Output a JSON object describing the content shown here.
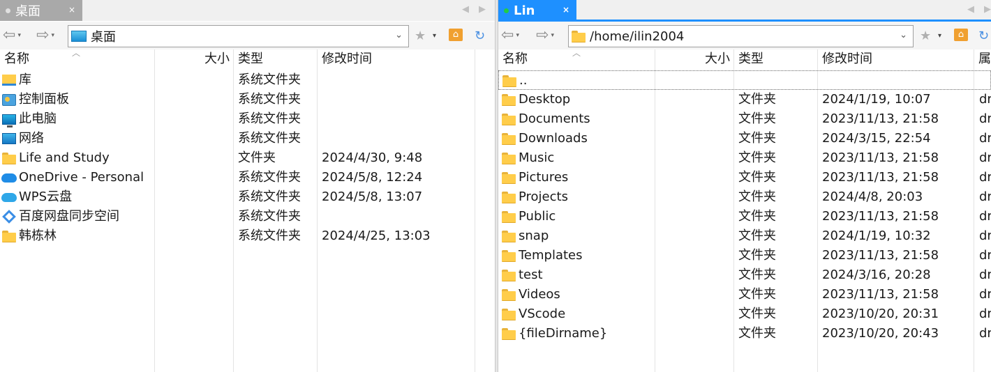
{
  "left": {
    "tab": {
      "label": "桌面",
      "close": "×",
      "dot_color": "#e0e0e0"
    },
    "address": "桌面",
    "columns": {
      "name": "名称",
      "size": "大小",
      "type": "类型",
      "modified": "修改时间"
    },
    "rows": [
      {
        "icon": "library-icon",
        "name": "库",
        "size": "",
        "type": "系统文件夹",
        "modified": ""
      },
      {
        "icon": "control-panel-icon",
        "name": "控制面板",
        "size": "",
        "type": "系统文件夹",
        "modified": ""
      },
      {
        "icon": "this-pc-icon",
        "name": "此电脑",
        "size": "",
        "type": "系统文件夹",
        "modified": ""
      },
      {
        "icon": "network-icon",
        "name": "网络",
        "size": "",
        "type": "系统文件夹",
        "modified": ""
      },
      {
        "icon": "folder-icon",
        "name": "Life and Study",
        "size": "",
        "type": "文件夹",
        "modified": "2024/4/30, 9:48"
      },
      {
        "icon": "onedrive-icon",
        "name": "OneDrive - Personal",
        "size": "",
        "type": "系统文件夹",
        "modified": "2024/5/8, 12:24"
      },
      {
        "icon": "wps-cloud-icon",
        "name": "WPS云盘",
        "size": "",
        "type": "系统文件夹",
        "modified": "2024/5/8, 13:07"
      },
      {
        "icon": "baidu-netdisk-icon",
        "name": "百度网盘同步空间",
        "size": "",
        "type": "系统文件夹",
        "modified": ""
      },
      {
        "icon": "folder-icon",
        "name": "韩栋林",
        "size": "",
        "type": "系统文件夹",
        "modified": "2024/4/25, 13:03"
      }
    ]
  },
  "right": {
    "tab": {
      "label": "Lin",
      "close": "×",
      "dot_color": "#22cc44"
    },
    "address": "/home/ilin2004",
    "columns": {
      "name": "名称",
      "size": "大小",
      "type": "类型",
      "modified": "修改时间",
      "attr": "属"
    },
    "updir": "..",
    "rows": [
      {
        "name": "Desktop",
        "type": "文件夹",
        "modified": "2024/1/19, 10:07",
        "attr": "dr"
      },
      {
        "name": "Documents",
        "type": "文件夹",
        "modified": "2023/11/13, 21:58",
        "attr": "dr"
      },
      {
        "name": "Downloads",
        "type": "文件夹",
        "modified": "2024/3/15, 22:54",
        "attr": "dr"
      },
      {
        "name": "Music",
        "type": "文件夹",
        "modified": "2023/11/13, 21:58",
        "attr": "dr"
      },
      {
        "name": "Pictures",
        "type": "文件夹",
        "modified": "2023/11/13, 21:58",
        "attr": "dr"
      },
      {
        "name": "Projects",
        "type": "文件夹",
        "modified": "2024/4/8, 20:03",
        "attr": "dr"
      },
      {
        "name": "Public",
        "type": "文件夹",
        "modified": "2023/11/13, 21:58",
        "attr": "dr"
      },
      {
        "name": "snap",
        "type": "文件夹",
        "modified": "2024/1/19, 10:32",
        "attr": "dr"
      },
      {
        "name": "Templates",
        "type": "文件夹",
        "modified": "2023/11/13, 21:58",
        "attr": "dr"
      },
      {
        "name": "test",
        "type": "文件夹",
        "modified": "2024/3/16, 20:28",
        "attr": "dr"
      },
      {
        "name": "Videos",
        "type": "文件夹",
        "modified": "2023/11/13, 21:58",
        "attr": "dr"
      },
      {
        "name": "VScode",
        "type": "文件夹",
        "modified": "2023/10/20, 20:31",
        "attr": "dr"
      },
      {
        "name": "{fileDirname}",
        "type": "文件夹",
        "modified": "2023/10/20, 20:43",
        "attr": "dr"
      }
    ]
  },
  "icons": {
    "back": "back-icon",
    "forward": "forward-icon",
    "bookmark": "star-icon",
    "home": "home-icon",
    "refresh": "refresh-icon",
    "dropdown": "chevron-down-icon"
  },
  "glyphs": {
    "back": "⇦",
    "forward": "⇨",
    "caret": "▾",
    "chevron": "⌄",
    "star": "★",
    "refresh": "↻",
    "home": "⌂",
    "sort": "︿",
    "tab_left": "◀",
    "tab_right": "▶"
  }
}
